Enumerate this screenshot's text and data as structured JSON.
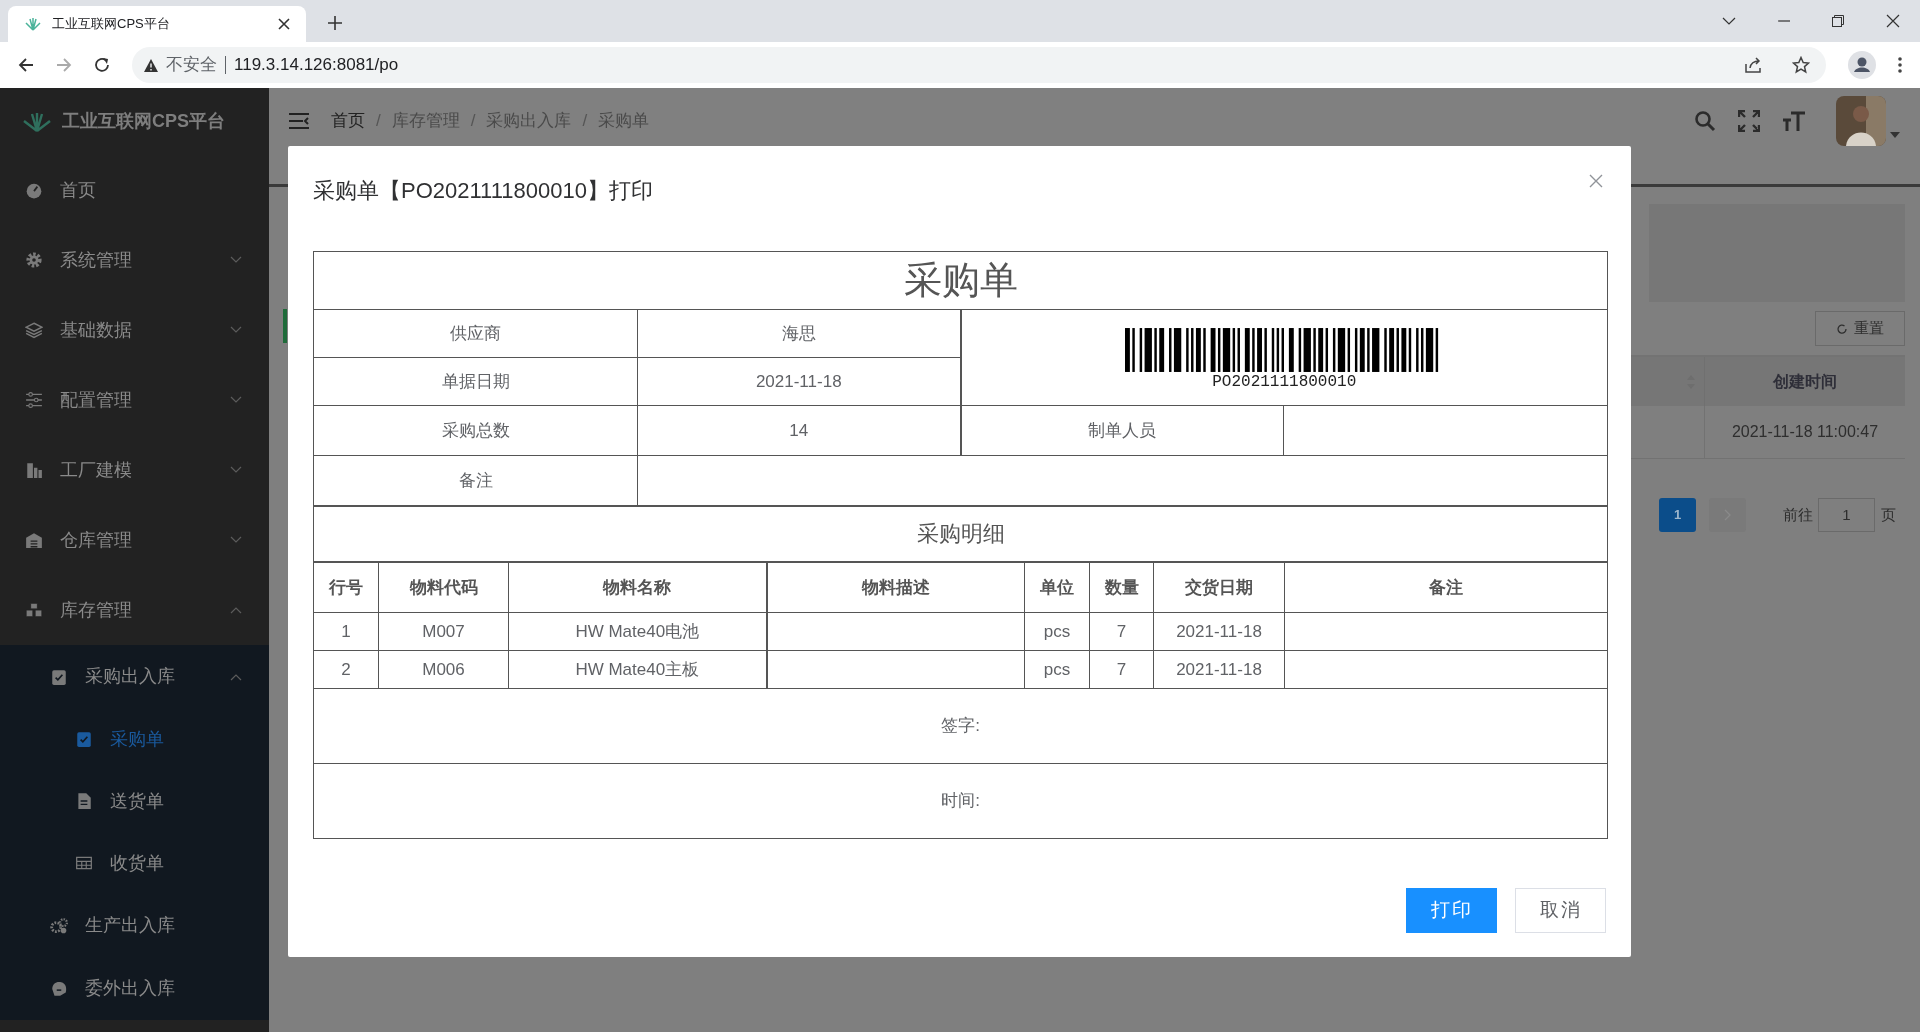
{
  "browser": {
    "tab_title": "工业互联网CPS平台",
    "security": "不安全",
    "url": "119.3.14.126:8081/po"
  },
  "sidebar": {
    "brand": "工业互联网CPS平台",
    "items": [
      {
        "label": "首页",
        "selected": false
      },
      {
        "label": "系统管理",
        "expanded": false,
        "selected": false
      },
      {
        "label": "基础数据",
        "expanded": false,
        "selected": false
      },
      {
        "label": "配置管理",
        "expanded": false,
        "selected": false
      },
      {
        "label": "工厂建模",
        "expanded": false,
        "selected": false
      },
      {
        "label": "仓库管理",
        "expanded": false,
        "selected": false
      },
      {
        "label": "库存管理",
        "expanded": true,
        "selected": false,
        "children": [
          {
            "label": "采购出入库",
            "expanded": true,
            "selected": false,
            "children": [
              {
                "label": "采购单",
                "selected": true
              },
              {
                "label": "送货单",
                "selected": false
              },
              {
                "label": "收货单",
                "selected": false
              }
            ]
          },
          {
            "label": "生产出入库",
            "selected": false
          },
          {
            "label": "委外出入库",
            "selected": false
          }
        ]
      }
    ]
  },
  "header": {
    "breadcrumbs": [
      "首页",
      "库存管理",
      "采购出入库",
      "采购单"
    ],
    "separator": "/"
  },
  "background": {
    "reset_button": "重置",
    "column": "创建时间",
    "cell": "2021-11-18 11:00:47",
    "pagination": {
      "page": "1",
      "goto": "前往",
      "page_input": "1",
      "page_unit": "页"
    }
  },
  "dialog": {
    "title": "采购单【PO2021111800010】打印",
    "document": {
      "title": "采购单",
      "fields": [
        {
          "label": "供应商",
          "value": "海思"
        },
        {
          "label": "单据日期",
          "value": "2021-11-18"
        },
        {
          "label": "采购总数",
          "value": "14"
        }
      ],
      "barcode_text": "PO2021111800010",
      "creator_label": "制单人员",
      "remark_label": "备注",
      "detail_title": "采购明细",
      "columns": [
        "行号",
        "物料代码",
        "物料名称",
        "物料描述",
        "单位",
        "数量",
        "交货日期",
        "备注"
      ],
      "rows": [
        [
          "1",
          "M007",
          "HW Mate40电池",
          "",
          "pcs",
          "7",
          "2021-11-18",
          ""
        ],
        [
          "2",
          "M006",
          "HW Mate40主板",
          "",
          "pcs",
          "7",
          "2021-11-18",
          ""
        ]
      ],
      "sign_label": "签字:",
      "time_label": "时间:"
    },
    "buttons": [
      {
        "label": "打印",
        "kind": "primary"
      },
      {
        "label": "取消",
        "kind": "default"
      }
    ]
  }
}
